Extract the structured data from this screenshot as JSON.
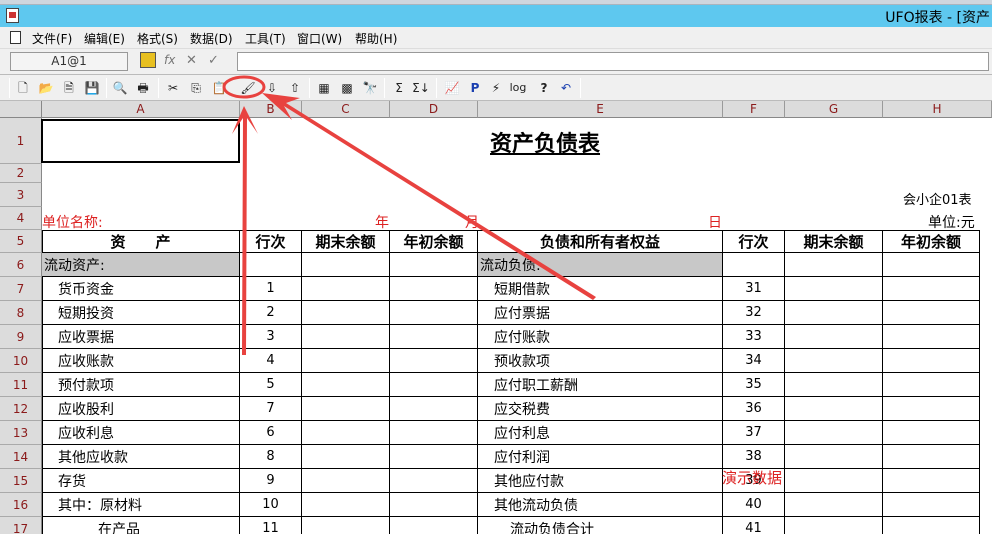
{
  "window": {
    "title": "UFO报表 - [资产"
  },
  "menu": [
    "文件(F)",
    "编辑(E)",
    "格式(S)",
    "数据(D)",
    "工具(T)",
    "窗口(W)",
    "帮助(H)"
  ],
  "formula_bar": {
    "cell_ref": "A1@1",
    "fx": "fx"
  },
  "toolbar": {
    "sigma": "Σ",
    "sigma2": "Σ↓",
    "p": "P",
    "log": "log",
    "help": "?"
  },
  "columns": [
    "A",
    "B",
    "C",
    "D",
    "E",
    "F",
    "G",
    "H"
  ],
  "rows": [
    "1",
    "2",
    "3",
    "4",
    "5",
    "6",
    "7",
    "8",
    "9",
    "10",
    "11",
    "12",
    "13",
    "14",
    "15",
    "16",
    "17"
  ],
  "sheet": {
    "title": "资产负债表",
    "form_code": "会小企01表",
    "unit_name_label": "单位名称:",
    "year": "年",
    "month": "月",
    "day": "日",
    "unit": "单位:元",
    "headers": [
      "资　　产",
      "行次",
      "期末余额",
      "年初余额",
      "负债和所有者权益",
      "行次",
      "期末余额",
      "年初余额"
    ],
    "assets_section": "流动资产:",
    "liab_section": "流动负债:",
    "assets": [
      {
        "name": "货币资金",
        "line": "1"
      },
      {
        "name": "短期投资",
        "line": "2"
      },
      {
        "name": "应收票据",
        "line": "3"
      },
      {
        "name": "应收账款",
        "line": "4"
      },
      {
        "name": "预付款项",
        "line": "5"
      },
      {
        "name": "应收股利",
        "line": "7"
      },
      {
        "name": "应收利息",
        "line": "6"
      },
      {
        "name": "其他应收款",
        "line": "8"
      },
      {
        "name": "存货",
        "line": "9"
      },
      {
        "name": "其中：原材料",
        "line": "10"
      },
      {
        "name": "在产品",
        "line": "11"
      }
    ],
    "liabilities": [
      {
        "name": "短期借款",
        "line": "31"
      },
      {
        "name": "应付票据",
        "line": "32"
      },
      {
        "name": "应付账款",
        "line": "33"
      },
      {
        "name": "预收款项",
        "line": "34"
      },
      {
        "name": "应付职工薪酬",
        "line": "35"
      },
      {
        "name": "应交税费",
        "line": "36"
      },
      {
        "name": "应付利息",
        "line": "37"
      },
      {
        "name": "应付利润",
        "line": "38"
      },
      {
        "name": "其他应付款",
        "line": "39"
      },
      {
        "name": "其他流动负债",
        "line": "40"
      },
      {
        "name": "流动负债合计",
        "line": "41"
      }
    ],
    "watermark": "演示数据"
  },
  "colors": {
    "titlebar": "#5ec8ef",
    "annotation": "#e8423f",
    "red_text": "#dd2222"
  }
}
